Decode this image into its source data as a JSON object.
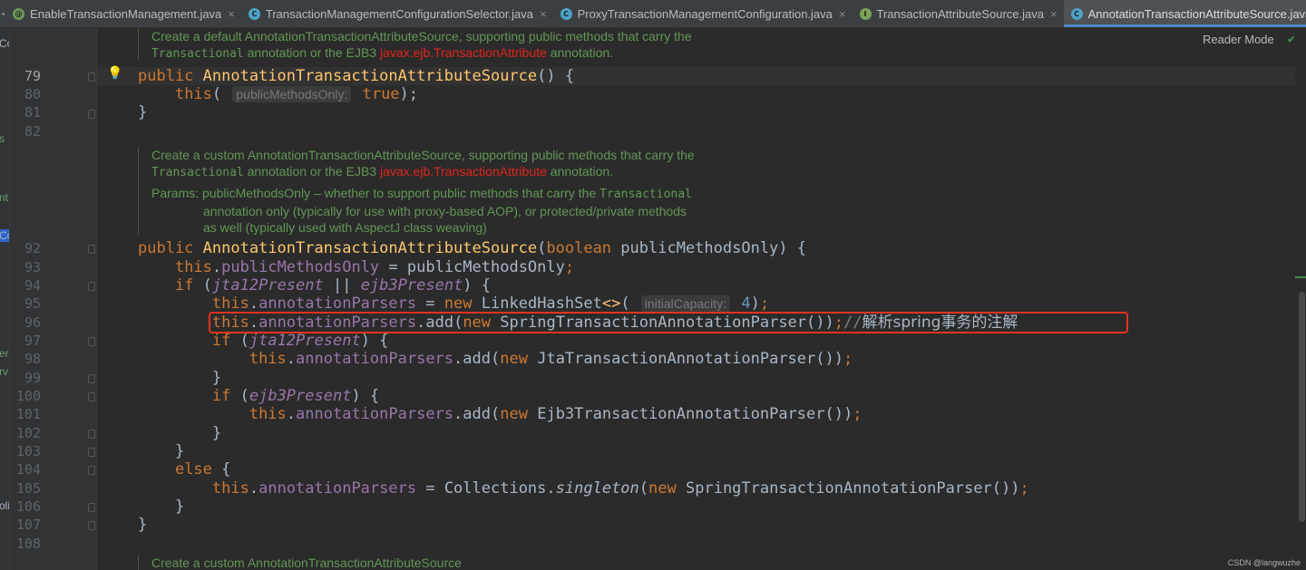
{
  "tabs": [
    {
      "label": "EnableTransactionManagement.java",
      "icon": "annotation-icon",
      "icon_color": "#6a9955",
      "icon_glyph": "@"
    },
    {
      "label": "TransactionManagementConfigurationSelector.java",
      "icon": "class-icon",
      "icon_color": "#4ca3c7",
      "icon_glyph": "C"
    },
    {
      "label": "ProxyTransactionManagementConfiguration.java",
      "icon": "class-icon",
      "icon_color": "#4ca3c7",
      "icon_glyph": "C"
    },
    {
      "label": "TransactionAttributeSource.java",
      "icon": "interface-icon",
      "icon_color": "#7aa35a",
      "icon_glyph": "I"
    },
    {
      "label": "AnnotationTransactionAttributeSource.java",
      "icon": "class-icon",
      "icon_color": "#4ca3c7",
      "icon_glyph": "C"
    }
  ],
  "close_glyph": "×",
  "reader_mode": "Reader Mode",
  "left_strip_fragments": [
    "Co",
    "s",
    "nt",
    "Co",
    "er",
    "rv",
    "olic"
  ],
  "line_numbers": [
    "79",
    "80",
    "81",
    "82",
    "92",
    "93",
    "94",
    "95",
    "96",
    "97",
    "98",
    "99",
    "100",
    "101",
    "102",
    "103",
    "104",
    "105",
    "106",
    "107",
    "108"
  ],
  "doc1": {
    "line1": "Create a default AnnotationTransactionAttributeSource, supporting public methods that carry the",
    "l2_mono": "Transactional",
    "l2_text": " annotation or the EJB3 ",
    "l2_red": "javax.ejb.TransactionAttribute",
    "l2_end": " annotation."
  },
  "doc2": {
    "line1": "Create a custom AnnotationTransactionAttributeSource, supporting public methods that carry the",
    "l2_mono": "Transactional",
    "l2_text": " annotation or the EJB3 ",
    "l2_red": "javax.ejb.TransactionAttribute",
    "l2_end": " annotation.",
    "params_label": "Params: ",
    "params_text": "publicMethodsOnly – whether to support public methods that carry the ",
    "params_mono": "Transactional",
    "params_cont1": "annotation only (typically for use with proxy-based AOP), or protected/private methods",
    "params_cont2": "as well (typically used with AspectJ class weaving)"
  },
  "doc3": {
    "line1": "Create a custom AnnotationTransactionAttributeSource"
  },
  "code": {
    "kw_public": "public",
    "kw_this": "this",
    "kw_boolean": "boolean",
    "kw_if": "if",
    "kw_new": "new",
    "kw_true": "true",
    "kw_else": "else",
    "ctor_name": "AnnotationTransactionAttributeSource",
    "hint_public_methods": "publicMethodsOnly:",
    "hint_initial_capacity": "initialCapacity:",
    "param_name": "publicMethodsOnly",
    "field_public_methods": "publicMethodsOnly",
    "field_parsers": "annotationParsers",
    "field_jta": "jta12Present",
    "field_ejb": "ejb3Present",
    "cls_linked": "LinkedHashSet",
    "diamond": "<>",
    "num_4": "4",
    "method_add": "add",
    "cls_spring_parser": "SpringTransactionAnnotationParser",
    "cls_jta_parser": "JtaTransactionAnnotationParser",
    "cls_ejb_parser": "Ejb3TransactionAnnotationParser",
    "cls_collections": "Collections",
    "method_singleton": "singleton",
    "comment_slashes": "//",
    "comment_cn": "解析spring事务的注解"
  },
  "watermark": "CSDN @langwuzhe"
}
